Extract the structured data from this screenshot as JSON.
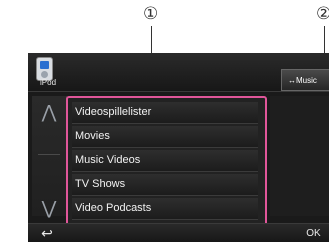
{
  "callouts": {
    "one": "①",
    "two": "②"
  },
  "source": {
    "label": "iPod",
    "icon": "ipod-icon"
  },
  "music_tab": {
    "label": "↔Music"
  },
  "scroll": {
    "up_icon": "double-chevron-up-icon",
    "up_glyph": "⋀",
    "down_icon": "double-chevron-down-icon",
    "down_glyph": "⋁"
  },
  "list": {
    "items": [
      "Videospillelister",
      "Movies",
      "Music Videos",
      "TV Shows",
      "Video Podcasts"
    ]
  },
  "bottom": {
    "back_glyph": "↩",
    "ok_label": "OK"
  },
  "colors": {
    "highlight": "#e0569a",
    "screen_bg": "#1a1a1a"
  }
}
